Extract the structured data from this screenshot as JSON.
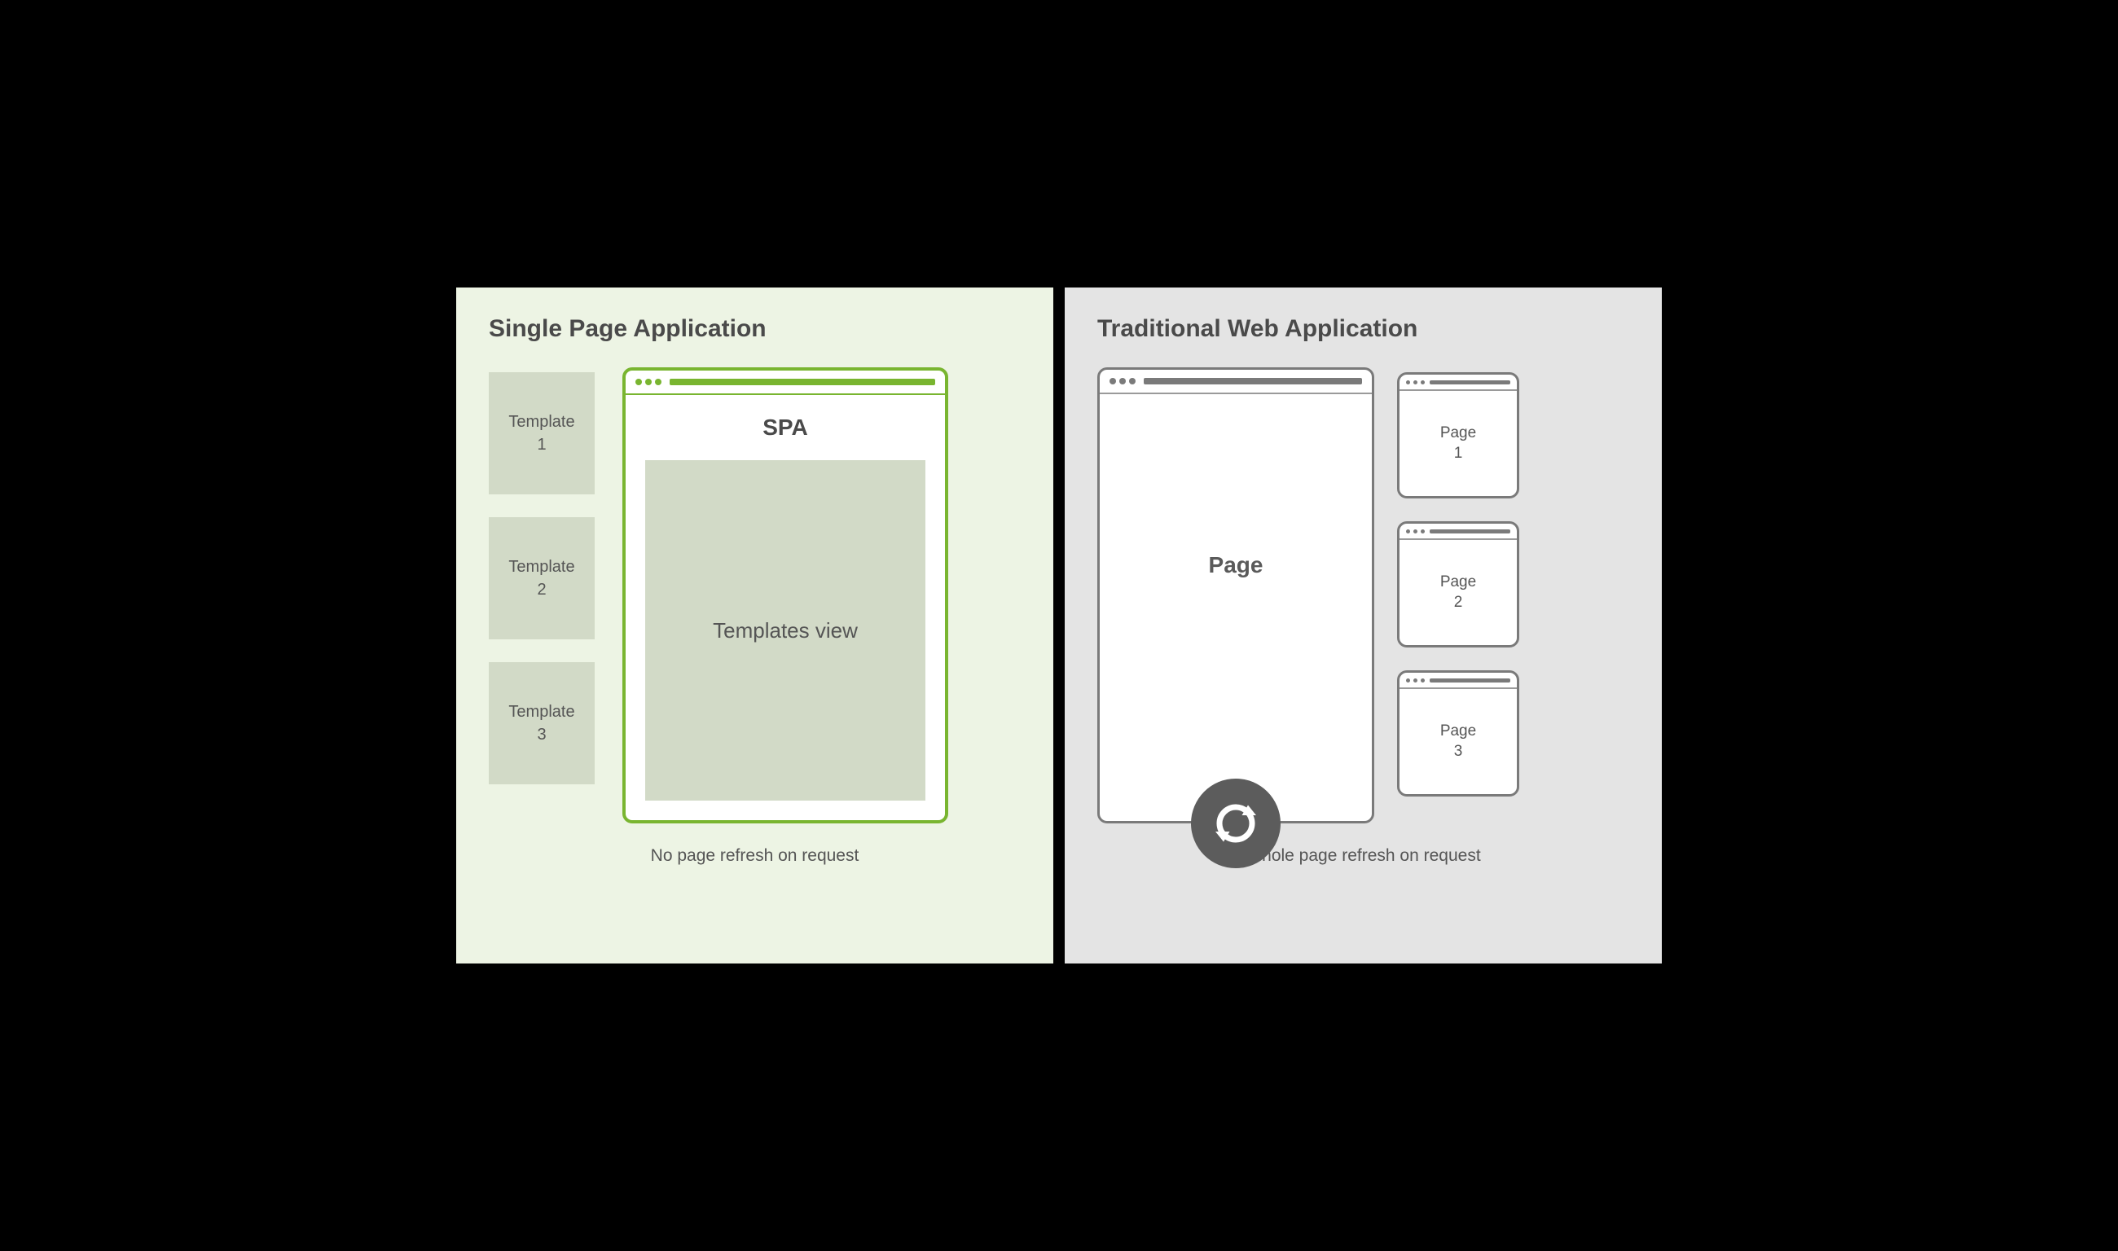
{
  "left": {
    "title": "Single Page Application",
    "templates": [
      "Template\n1",
      "Template\n2",
      "Template\n3"
    ],
    "browser_heading": "SPA",
    "templates_view_label": "Templates view",
    "caption": "No page refresh on request"
  },
  "right": {
    "title": "Traditional Web Application",
    "page_heading": "Page",
    "pages": [
      "Page\n1",
      "Page\n2",
      "Page\n3"
    ],
    "caption": "Whole page refresh on request"
  },
  "colors": {
    "green": "#79b530",
    "gray": "#7a7a7a",
    "left_bg": "#edf4e4",
    "right_bg": "#e4e4e4",
    "template_fill": "#d2dac7"
  }
}
